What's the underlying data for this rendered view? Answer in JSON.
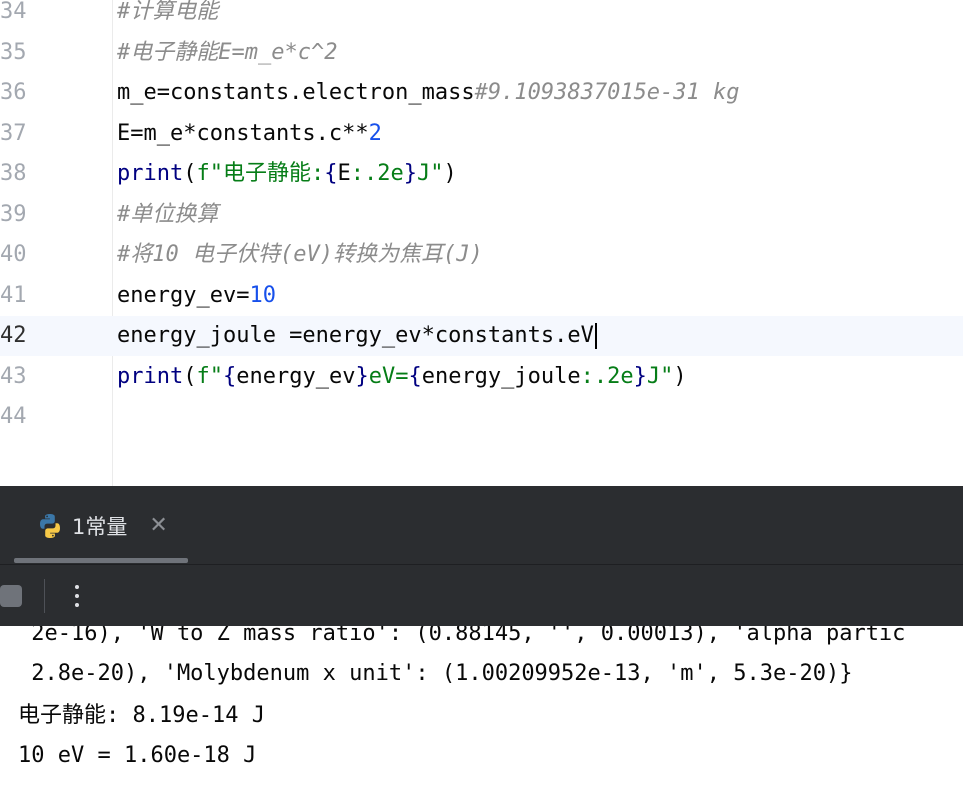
{
  "editor": {
    "lines": [
      {
        "n": "34",
        "parts": [
          {
            "t": "#计算电能",
            "c": "cm"
          }
        ]
      },
      {
        "n": "35",
        "parts": [
          {
            "t": "#电子静能E=m_e*c^2",
            "c": "cm"
          }
        ]
      },
      {
        "n": "36",
        "parts": [
          {
            "t": "m_e=constants.electron_mass",
            "c": ""
          },
          {
            "t": "#9.1093837015e-31 kg",
            "c": "cm"
          }
        ]
      },
      {
        "n": "37",
        "parts": [
          {
            "t": "E=m_e*constants.c**",
            "c": ""
          },
          {
            "t": "2",
            "c": "num"
          }
        ]
      },
      {
        "n": "38",
        "parts": [
          {
            "t": "print",
            "c": "kw"
          },
          {
            "t": "(",
            "c": ""
          },
          {
            "t": "f\"电子静能:",
            "c": "str"
          },
          {
            "t": "{",
            "c": "kw"
          },
          {
            "t": "E",
            "c": ""
          },
          {
            "t": ":.2e",
            "c": "str"
          },
          {
            "t": "}",
            "c": "kw"
          },
          {
            "t": "J\"",
            "c": "str"
          },
          {
            "t": ")",
            "c": ""
          }
        ]
      },
      {
        "n": "39",
        "parts": [
          {
            "t": "#单位换算",
            "c": "cm"
          }
        ]
      },
      {
        "n": "40",
        "parts": [
          {
            "t": "#将10 电子伏特(eV)转换为焦耳(J)",
            "c": "cm"
          }
        ]
      },
      {
        "n": "41",
        "parts": [
          {
            "t": "energy_ev=",
            "c": ""
          },
          {
            "t": "10",
            "c": "num"
          }
        ]
      },
      {
        "n": "42",
        "current": true,
        "parts": [
          {
            "t": "energy_joule =energy_ev*constants.eV",
            "c": ""
          }
        ]
      },
      {
        "n": "43",
        "parts": [
          {
            "t": "print",
            "c": "kw"
          },
          {
            "t": "(",
            "c": ""
          },
          {
            "t": "f\"",
            "c": "str"
          },
          {
            "t": "{",
            "c": "kw"
          },
          {
            "t": "energy_ev",
            "c": ""
          },
          {
            "t": "}",
            "c": "kw"
          },
          {
            "t": "eV=",
            "c": "str"
          },
          {
            "t": "{",
            "c": "kw"
          },
          {
            "t": "energy_joule",
            "c": ""
          },
          {
            "t": ":.2e",
            "c": "str"
          },
          {
            "t": "}",
            "c": "kw"
          },
          {
            "t": "J\"",
            "c": "str"
          },
          {
            "t": ")",
            "c": ""
          }
        ]
      },
      {
        "n": "44",
        "parts": []
      }
    ]
  },
  "run_panel": {
    "tab_icon": "python-icon",
    "tab_label": "1常量",
    "close_icon": "close-icon",
    "toolbar": {
      "stop_icon": "stop-icon",
      "more_icon": "more-vertical-icon"
    }
  },
  "console": {
    "lines": [
      " 2e-16), 'W to Z mass ratio': (0.88145, '', 0.00013), 'alpha partic",
      " 2.8e-20), 'Molybdenum x unit': (1.00209952e-13, 'm', 5.3e-20)}",
      "电子静能: 8.19e-14 J",
      "10 eV = 1.60e-18 J"
    ]
  },
  "colors": {
    "comment": "#8c8c8c",
    "keyword": "#000080",
    "string": "#067d17",
    "number": "#1750eb",
    "panel_bg": "#2b2d30",
    "current_line": "#f5f8fe"
  }
}
